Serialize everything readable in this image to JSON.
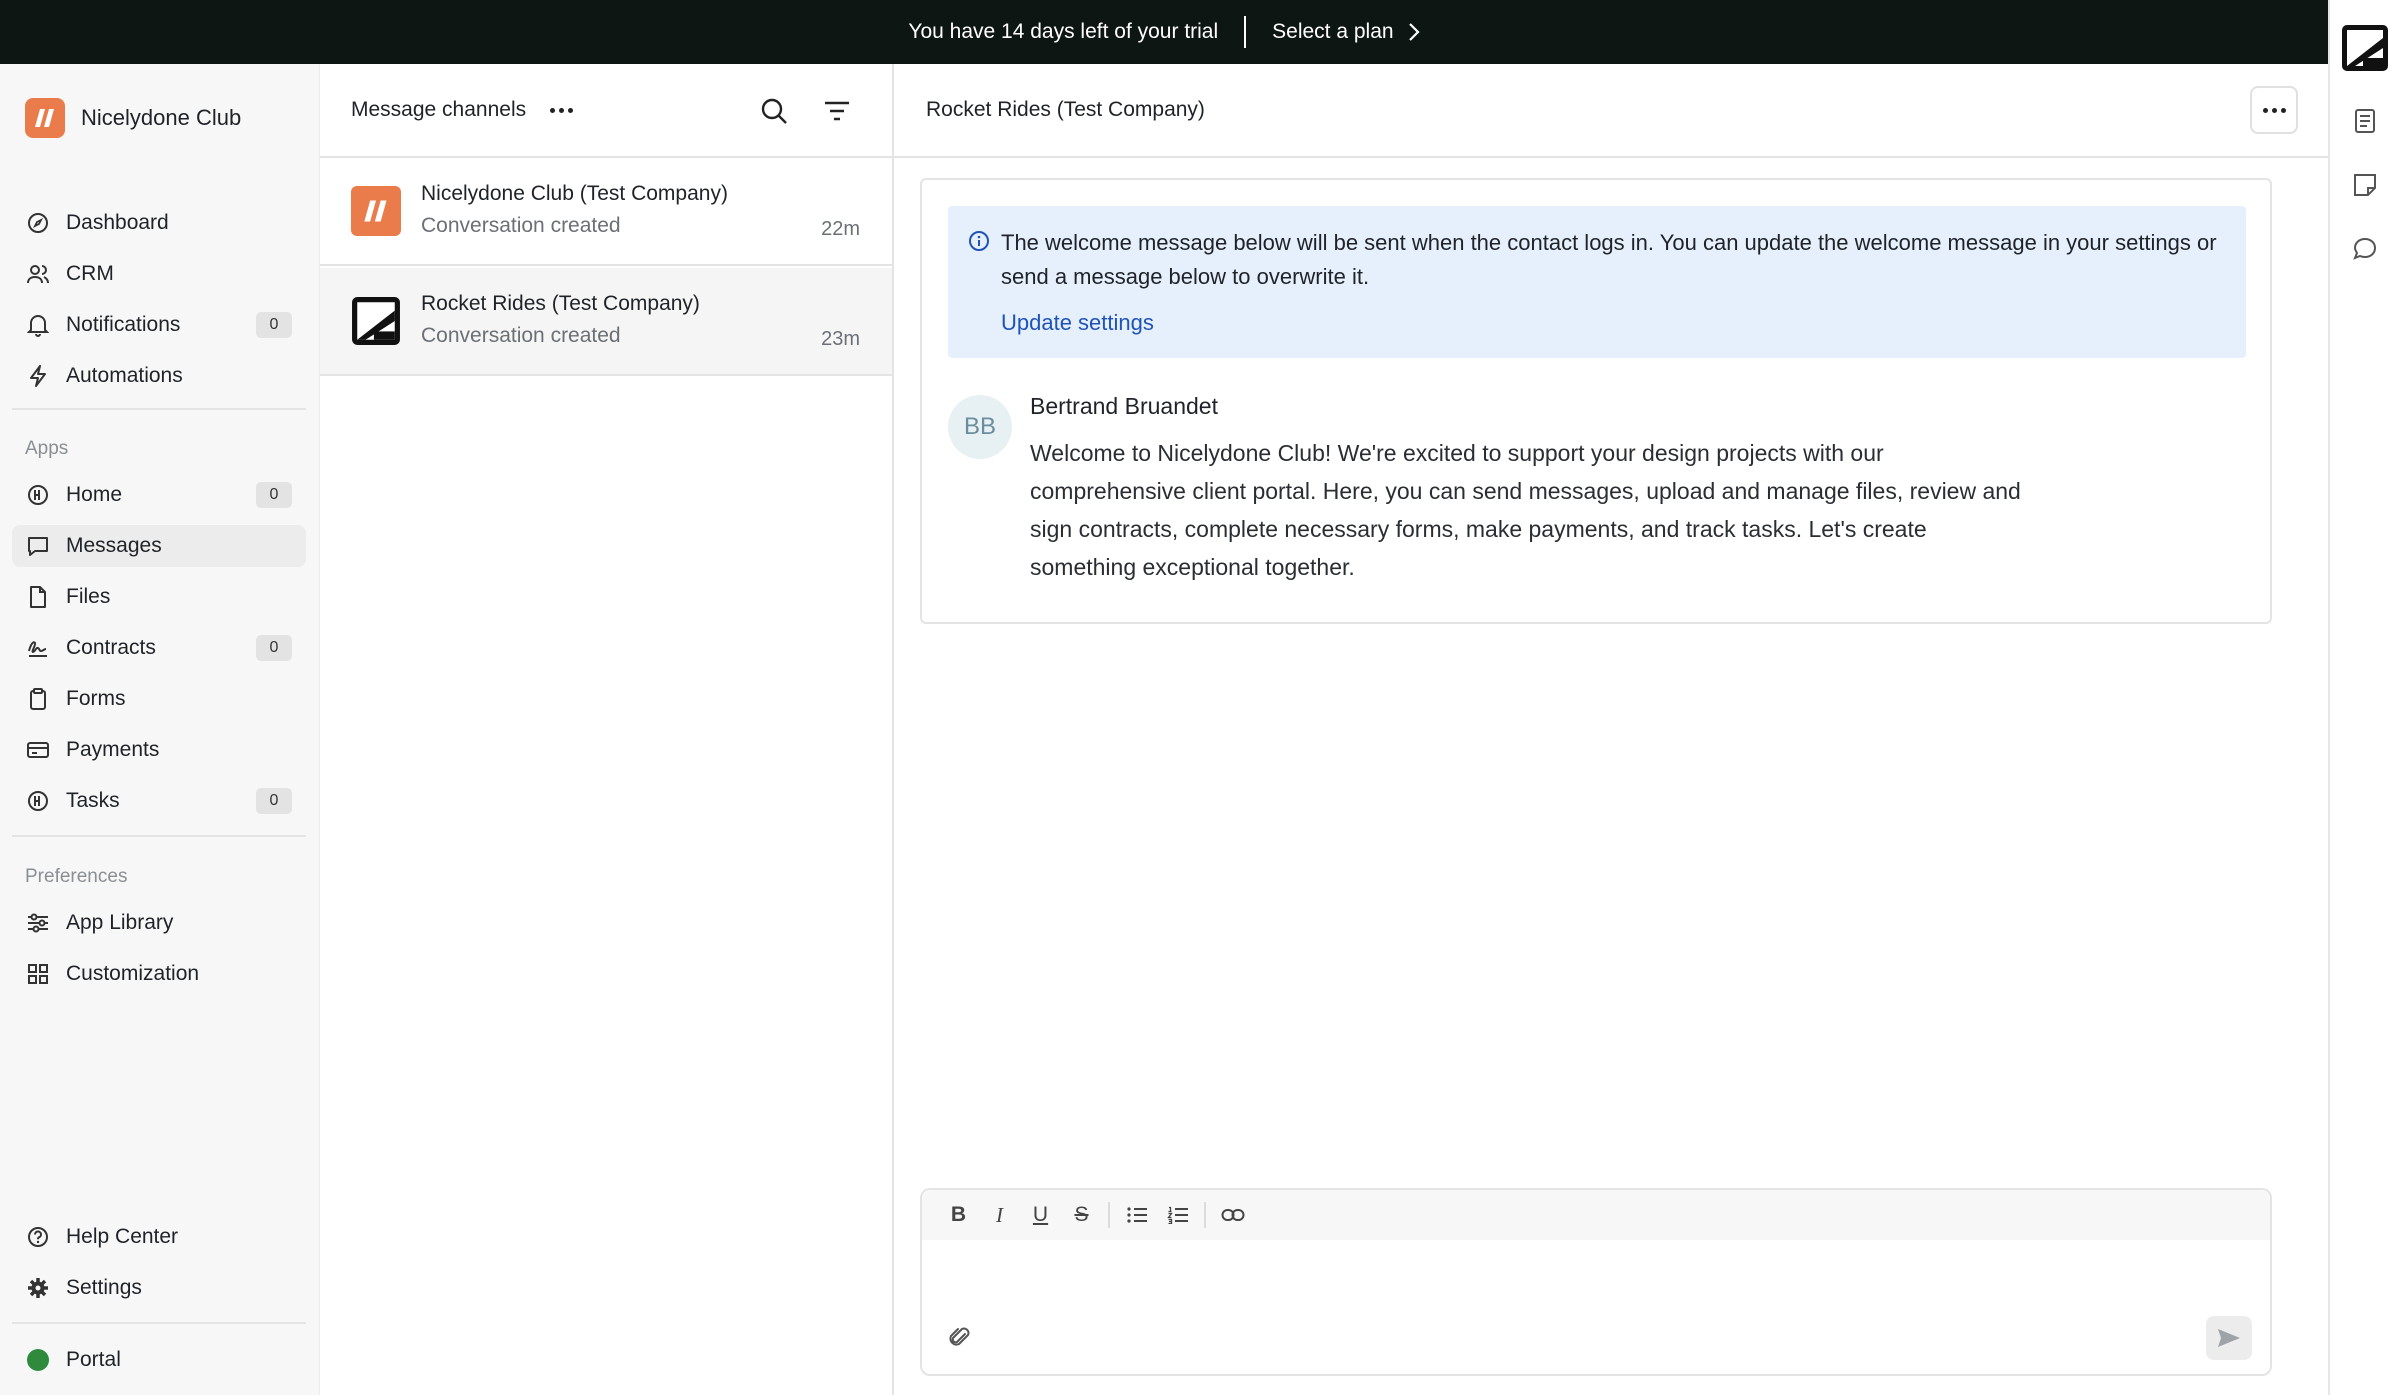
{
  "banner": {
    "trial_text": "You have 14 days left of your trial",
    "cta": "Select a plan"
  },
  "brand": {
    "name": "Nicelydone Club",
    "color": "#ea7b4a"
  },
  "sidebar": {
    "main": [
      {
        "label": "Dashboard",
        "icon": "compass-icon"
      },
      {
        "label": "CRM",
        "icon": "users-icon"
      },
      {
        "label": "Notifications",
        "icon": "bell-icon",
        "count": "0"
      },
      {
        "label": "Automations",
        "icon": "bolt-icon"
      }
    ],
    "apps_label": "Apps",
    "apps": [
      {
        "label": "Home",
        "icon": "home-icon",
        "count": "0"
      },
      {
        "label": "Messages",
        "icon": "message-icon",
        "active": true
      },
      {
        "label": "Files",
        "icon": "file-icon"
      },
      {
        "label": "Contracts",
        "icon": "signature-icon",
        "count": "0"
      },
      {
        "label": "Forms",
        "icon": "clipboard-icon"
      },
      {
        "label": "Payments",
        "icon": "credit-card-icon"
      },
      {
        "label": "Tasks",
        "icon": "tasks-icon",
        "count": "0"
      }
    ],
    "preferences_label": "Preferences",
    "preferences": [
      {
        "label": "App Library",
        "icon": "sliders-icon"
      },
      {
        "label": "Customization",
        "icon": "grid-icon"
      }
    ],
    "footer": [
      {
        "label": "Help Center",
        "icon": "help-icon"
      },
      {
        "label": "Settings",
        "icon": "gear-icon"
      }
    ],
    "portal": {
      "label": "Portal",
      "status_color": "#2f8a3e"
    }
  },
  "channels": {
    "title": "Message channels",
    "items": [
      {
        "name": "Nicelydone Club (Test Company)",
        "subtitle": "Conversation created",
        "time": "22m"
      },
      {
        "name": "Rocket Rides (Test Company)",
        "subtitle": "Conversation created",
        "time": "23m",
        "active": true
      }
    ]
  },
  "conversation": {
    "title": "Rocket Rides (Test Company)",
    "info": {
      "text": "The welcome message below will be sent when the contact logs in. You can update the welcome message in your settings or send a message below to overwrite it.",
      "link": "Update settings"
    },
    "message": {
      "initials": "BB",
      "author": "Bertrand Bruandet",
      "body": "Welcome to Nicelydone Club! We're excited to support your design projects with our comprehensive client portal. Here, you can send messages, upload and manage files, review and sign contracts, complete necessary forms, make payments, and track tasks. Let's create something exceptional together."
    }
  },
  "composer": {
    "tools": [
      {
        "label": "B",
        "icon": "bold-icon"
      },
      {
        "label": "I",
        "icon": "italic-icon"
      },
      {
        "label": "U",
        "icon": "underline-icon"
      },
      {
        "label": "S",
        "icon": "strikethrough-icon"
      }
    ]
  }
}
